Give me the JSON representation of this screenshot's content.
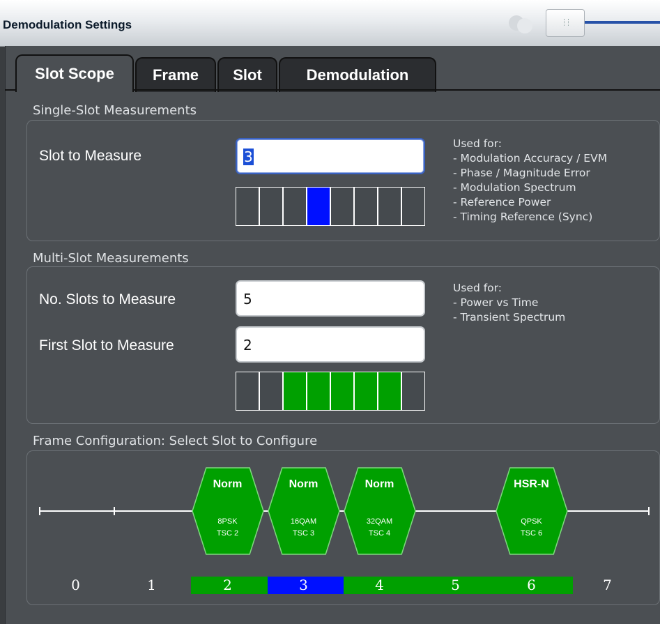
{
  "window": {
    "title": "Demodulation Settings"
  },
  "tabs": [
    {
      "label": "Slot Scope",
      "active": true
    },
    {
      "label": "Frame",
      "active": false
    },
    {
      "label": "Slot",
      "active": false
    },
    {
      "label": "Demodulation",
      "active": false
    }
  ],
  "single_slot": {
    "heading": "Single-Slot Measurements",
    "slot_label": "Slot to Measure",
    "slot_value": "3",
    "used_for": [
      "Used for:",
      "- Modulation Accuracy / EVM",
      "- Phase / Magnitude Error",
      "- Modulation Spectrum",
      "- Reference Power",
      "- Timing Reference (Sync)"
    ],
    "selected_slot_index": 3,
    "slot_count": 8
  },
  "multi_slot": {
    "heading": "Multi-Slot Measurements",
    "num_label": "No. Slots to Measure",
    "num_value": "5",
    "first_label": "First Slot to Measure",
    "first_value": "2",
    "used_for": [
      "Used for:",
      "- Power vs Time",
      "- Transient Spectrum"
    ],
    "selected_range": [
      2,
      6
    ],
    "slot_count": 8
  },
  "frame_config": {
    "heading": "Frame Configuration: Select Slot to Configure",
    "slots": [
      {
        "number": "0",
        "active": false
      },
      {
        "number": "1",
        "active": false
      },
      {
        "number": "2",
        "active": true,
        "burst": "Norm",
        "modulation": "8PSK",
        "tsc": "TSC 2"
      },
      {
        "number": "3",
        "active": true,
        "burst": "Norm",
        "modulation": "16QAM",
        "tsc": "TSC 3"
      },
      {
        "number": "4",
        "active": true,
        "burst": "Norm",
        "modulation": "32QAM",
        "tsc": "TSC 4"
      },
      {
        "number": "5",
        "active": false
      },
      {
        "number": "6",
        "active": true,
        "burst": "HSR-N",
        "modulation": "QPSK",
        "tsc": "TSC 6"
      },
      {
        "number": "7",
        "active": false
      }
    ],
    "number_bar_colors": {
      "green": "#00a000",
      "blue": "#0010ff"
    }
  },
  "colors": {
    "accent_blue": "#0010ff",
    "accent_green": "#00a000",
    "background": "#4b4f53"
  }
}
